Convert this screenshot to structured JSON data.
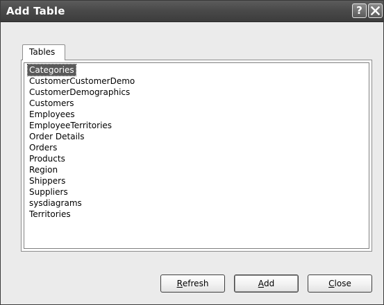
{
  "window": {
    "title": "Add Table",
    "help_glyph": "?",
    "icons": {
      "help": "help-icon",
      "close": "close-x-icon"
    }
  },
  "tabs": [
    {
      "label": "Tables",
      "active": true
    }
  ],
  "tables_list": {
    "selected": "Categories",
    "items": [
      "Categories",
      "CustomerCustomerDemo",
      "CustomerDemographics",
      "Customers",
      "Employees",
      "EmployeeTerritories",
      "Order Details",
      "Orders",
      "Products",
      "Region",
      "Shippers",
      "Suppliers",
      "sysdiagrams",
      "Territories"
    ]
  },
  "buttons": {
    "refresh": {
      "access_key": "R",
      "rest": "efresh"
    },
    "add": {
      "access_key": "A",
      "rest": "dd"
    },
    "close": {
      "access_key": "C",
      "rest": "lose"
    }
  },
  "colors": {
    "titlebar": "#4a4a4a",
    "dialog_bg": "#ebebeb",
    "selection": "#5a5a5a"
  }
}
